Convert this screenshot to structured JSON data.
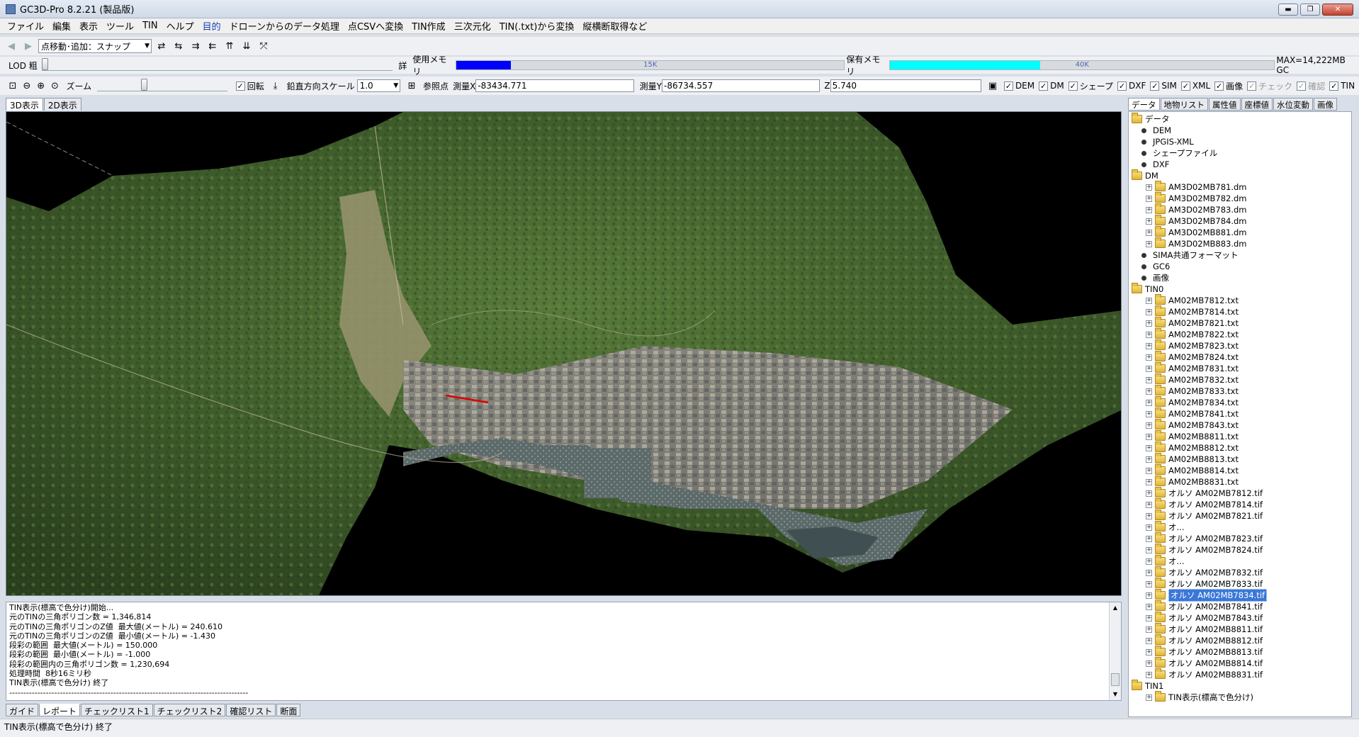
{
  "window": {
    "title": "GC3D-Pro 8.2.21 (製品版)",
    "min": "▬",
    "max": "❐",
    "close": "✕"
  },
  "menu": [
    "ファイル",
    "編集",
    "表示",
    "ツール",
    "TIN",
    "ヘルプ",
    "目的",
    "ドローンからのデータ処理",
    "点CSVへ変換",
    "TIN作成",
    "三次元化",
    "TIN(.txt)から変換",
    "縦横断取得など"
  ],
  "toolbar1": {
    "mode_combo": "点移動･追加：スナップ"
  },
  "lodrow": {
    "lod_label": "LOD 粗",
    "detail_label": "詳",
    "used_mem_label": "使用メモリ",
    "used_mem_value": "15K",
    "used_mem_fraction": 0.14,
    "held_mem_label": "保有メモリ",
    "held_mem_value": "40K",
    "held_mem_fraction": 0.39,
    "max_label": "MAX=14,222MB GC",
    "used_color": "#0000ff",
    "held_color": "#00ffff"
  },
  "toolbar2": {
    "zoom_label": "ズーム",
    "rotate_label": "回転",
    "vscale_label": "鉛直方向スケール",
    "vscale_value": "1.0",
    "ref_label": "参照点",
    "x_label": "測量X",
    "x_value": "-83434.771",
    "y_label": "測量Y",
    "y_value": "-86734.557",
    "z_label": "Z",
    "z_value": "5.740",
    "layers": [
      {
        "label": "DEM",
        "checked": true,
        "enabled": true
      },
      {
        "label": "DM",
        "checked": true,
        "enabled": true
      },
      {
        "label": "シェープ",
        "checked": true,
        "enabled": true
      },
      {
        "label": "DXF",
        "checked": true,
        "enabled": true
      },
      {
        "label": "SIM",
        "checked": true,
        "enabled": true
      },
      {
        "label": "XML",
        "checked": true,
        "enabled": true
      },
      {
        "label": "画像",
        "checked": true,
        "enabled": true
      },
      {
        "label": "チェック",
        "checked": true,
        "enabled": false
      },
      {
        "label": "確認",
        "checked": true,
        "enabled": false
      },
      {
        "label": "TIN",
        "checked": true,
        "enabled": true
      }
    ]
  },
  "view_tabs": [
    "3D表示",
    "2D表示"
  ],
  "console_lines": [
    "TIN表示(標高で色分け)開始...",
    "元のTINの三角ポリゴン数 = 1,346,814",
    "元のTINの三角ポリゴンのZ値  最大値(メートル) = 240.610",
    "元のTINの三角ポリゴンのZ値  最小値(メートル) = -1.430",
    "段彩の範囲  最大値(メートル) = 150.000",
    "段彩の範囲  最小値(メートル) = -1.000",
    "段彩の範囲内の三角ポリゴン数 = 1,230,694",
    "処理時間  8秒16ミリ秒",
    "TIN表示(標高で色分け) 終了",
    "-------------------------------------------------------------------------------------"
  ],
  "bottom_tabs": [
    "ガイド",
    "レポート",
    "チェックリスト1",
    "チェックリスト2",
    "確認リスト",
    "断面"
  ],
  "status": "TIN表示(標高で色分け) 終了",
  "right_tabs": [
    "データ",
    "地物リスト",
    "属性値",
    "座標値",
    "水位変動",
    "画像"
  ],
  "tree": {
    "root": "データ",
    "top": [
      "DEM",
      "JPGIS-XML",
      "シェープファイル",
      "DXF"
    ],
    "dm_label": "DM",
    "dm_items": [
      "AM3D02MB781.dm",
      "AM3D02MB782.dm",
      "AM3D02MB783.dm",
      "AM3D02MB784.dm",
      "AM3D02MB881.dm",
      "AM3D02MB883.dm"
    ],
    "mid": [
      "SIMA共通フォーマット",
      "GC6",
      "画像"
    ],
    "tin0_label": "TIN0",
    "tin0_items": [
      "AM02MB7812.txt",
      "AM02MB7814.txt",
      "AM02MB7821.txt",
      "AM02MB7822.txt",
      "AM02MB7823.txt",
      "AM02MB7824.txt",
      "AM02MB7831.txt",
      "AM02MB7832.txt",
      "AM02MB7833.txt",
      "AM02MB7834.txt",
      "AM02MB7841.txt",
      "AM02MB7843.txt",
      "AM02MB8811.txt",
      "AM02MB8812.txt",
      "AM02MB8813.txt",
      "AM02MB8814.txt",
      "AM02MB8831.txt",
      "オルソ AM02MB7812.tif",
      "オルソ AM02MB7814.tif",
      "オルソ AM02MB7821.tif",
      "オ...",
      "オルソ AM02MB7823.tif",
      "オルソ AM02MB7824.tif",
      "オ...",
      "オルソ AM02MB7832.tif",
      "オルソ AM02MB7833.tif",
      "オルソ AM02MB7834.tif",
      "オルソ AM02MB7841.tif",
      "オルソ AM02MB7843.tif",
      "オルソ AM02MB8811.tif",
      "オルソ AM02MB8812.tif",
      "オルソ AM02MB8813.tif",
      "オルソ AM02MB8814.tif",
      "オルソ AM02MB8831.tif"
    ],
    "selected": "オルソ AM02MB7834.tif",
    "tin1_label": "TIN1",
    "tin1_items": [
      "TIN表示(標高で色分け)"
    ]
  }
}
